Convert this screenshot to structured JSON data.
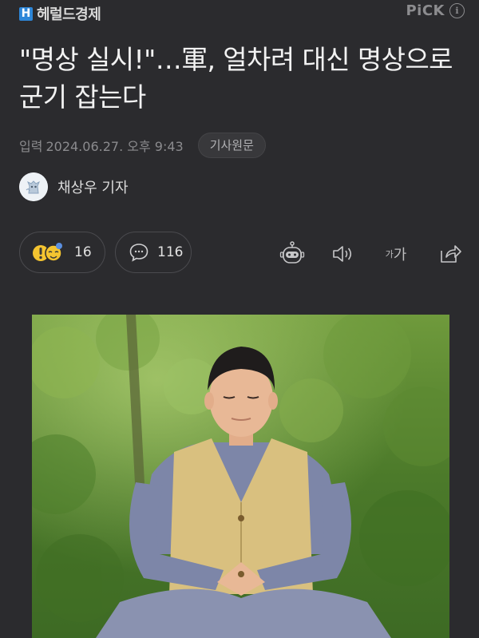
{
  "header": {
    "logo_mark": "H",
    "logo_text": "헤럴드경제",
    "pick_label": "PiCK",
    "info_icon": "i"
  },
  "article": {
    "title": "\"명상 실시!\"…軍, 얼차려 대신 명상으로 군기 잡는다",
    "input_label": "입력",
    "date": "2024.06.27. 오후 9:43",
    "original_button": "기사원문",
    "reporter": "채상우 기자"
  },
  "reactions": {
    "reaction_count": "16",
    "comment_count": "116"
  },
  "toolbar": {
    "icons": [
      "robot-summary-icon",
      "speaker-icon",
      "font-size-icon",
      "share-icon"
    ],
    "font_small": "가",
    "font_large": "가"
  },
  "image": {
    "description_icon": "meditating-man-photo"
  },
  "colors": {
    "background": "#2b2b2e",
    "logo_blue": "#2d86d8",
    "meta_gray": "#8b8b8e",
    "reaction_yellow": "#f4c430"
  }
}
